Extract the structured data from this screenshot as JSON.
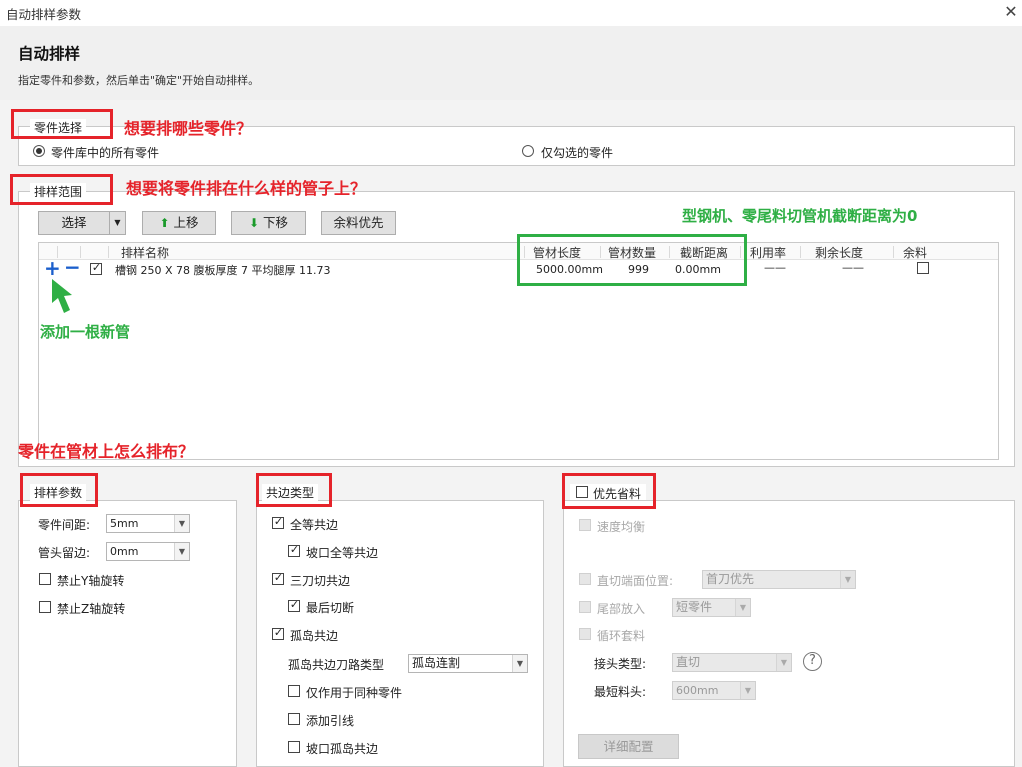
{
  "window": {
    "title": "自动排样参数",
    "close_glyph": "✕"
  },
  "header": {
    "title": "自动排样",
    "subtitle": "指定零件和参数，然后单击\"确定\"开始自动排样。"
  },
  "part_selection": {
    "legend": "零件选择",
    "options": [
      {
        "label": "零件库中的所有零件",
        "selected": true
      },
      {
        "label": "仅勾选的零件",
        "selected": false
      }
    ]
  },
  "nesting_range": {
    "legend": "排样范围",
    "toolbar": {
      "select": "选择",
      "dropdown_glyph": "▼",
      "up": "上移",
      "down": "下移",
      "remnant": "余料优先",
      "up_glyph": "⬆",
      "down_glyph": "⬇"
    },
    "columns": [
      "排样名称",
      "管材长度",
      "管材数量",
      "截断距离",
      "利用率",
      "剩余长度",
      "余料"
    ],
    "rows": [
      {
        "add_glyph": "+",
        "remove_glyph": "−",
        "checked": true,
        "name": "槽钢 250 X 78 腹板厚度 7 平均腿厚 11.73",
        "length": "5000.00mm",
        "quantity": "999",
        "cut_distance": "0.00mm",
        "utilization": "——",
        "remaining": "——",
        "remnant": false
      }
    ]
  },
  "nesting_params": {
    "legend": "排样参数",
    "part_spacing_label": "零件间距:",
    "part_spacing_value": "5mm",
    "head_margin_label": "管头留边:",
    "head_margin_value": "0mm",
    "no_y_rotation": {
      "label": "禁止Y轴旋转",
      "checked": false
    },
    "no_z_rotation": {
      "label": "禁止Z轴旋转",
      "checked": false
    }
  },
  "common_edge": {
    "legend": "共边类型",
    "items": [
      {
        "label": "全等共边",
        "checked": true
      },
      {
        "label": "坡口全等共边",
        "checked": true
      },
      {
        "label": "三刀切共边",
        "checked": true
      },
      {
        "label": "最后切断",
        "checked": true
      },
      {
        "label": "孤岛共边",
        "checked": true
      }
    ],
    "island_path_label": "孤岛共边刀路类型",
    "island_path_value": "孤岛连割",
    "island_options": [
      {
        "label": "仅作用于同种零件",
        "checked": false
      },
      {
        "label": "添加引线",
        "checked": false
      },
      {
        "label": "坡口孤岛共边",
        "checked": false
      }
    ]
  },
  "material_saving": {
    "legend": "优先省料",
    "checked": false,
    "speed_balance": "速度均衡",
    "straight_cut_label": "直切端面位置:",
    "straight_cut_value": "首刀优先",
    "tail_label": "尾部放入",
    "tail_value": "短零件",
    "loop_label": "循环套料",
    "joint_label": "接头类型:",
    "joint_value": "直切",
    "help_glyph": "?",
    "min_head_label": "最短料头:",
    "min_head_value": "600mm",
    "detail_button": "详细配置"
  },
  "annotations": {
    "q1": "想要排哪些零件？",
    "q2": "想要将零件排在什么样的管子上？",
    "note_cut": "型钢机、零尾料切管机截断距离为0",
    "note_add": "添加一根新管",
    "q3": "零件在管材上怎么排布？",
    "red": "#e5232a",
    "green": "#2faf45"
  }
}
